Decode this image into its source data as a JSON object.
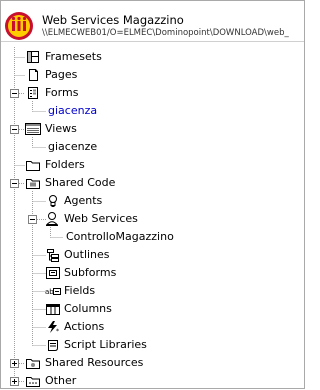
{
  "header": {
    "title": "Web Services Magazzino",
    "path": "\\\\ELMECWEB01/O=ELMEC\\Dominopoint\\DOWNLOAD\\web_"
  },
  "tree": {
    "framesets": "Framesets",
    "pages": "Pages",
    "forms": "Forms",
    "forms_child": "giacenza",
    "views": "Views",
    "views_child": "giacenze",
    "folders": "Folders",
    "shared_code": "Shared Code",
    "agents": "Agents",
    "web_services": "Web Services",
    "web_services_child": "ControlloMagazzino",
    "outlines": "Outlines",
    "subforms": "Subforms",
    "fields": "Fields",
    "columns": "Columns",
    "actions": "Actions",
    "script_libraries": "Script Libraries",
    "shared_resources": "Shared Resources",
    "other": "Other"
  }
}
